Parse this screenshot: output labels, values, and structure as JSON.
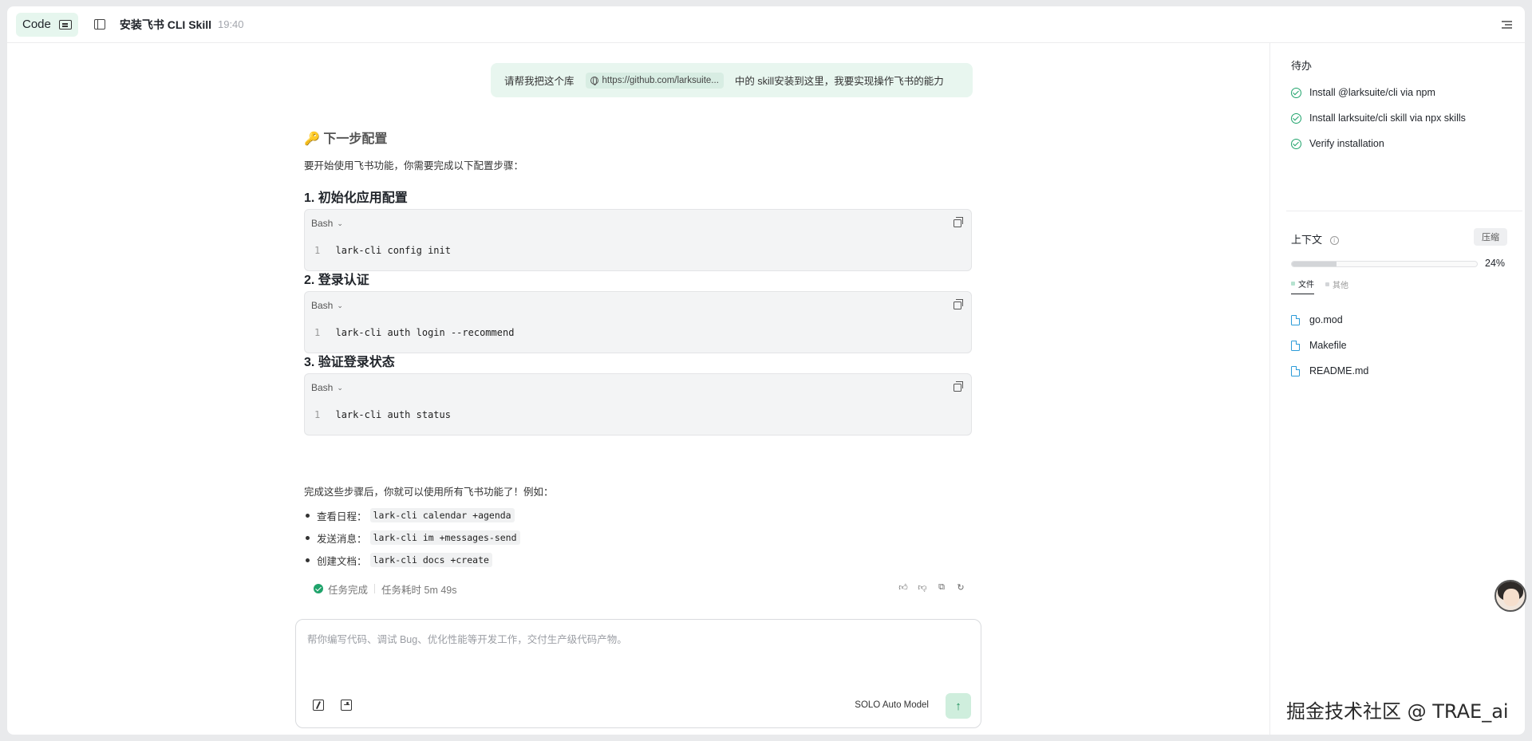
{
  "header": {
    "code_label": "Code",
    "title": "安装飞书 CLI Skill",
    "time": "19:40"
  },
  "user_message": {
    "prefix": "请帮我把这个库",
    "link": "https://github.com/larksuite...",
    "suffix": "中的 skill安装到这里，我要实现操作飞书的能力"
  },
  "response": {
    "next_heading": "🔑 下一步配置",
    "intro": "要开始使用飞书功能，你需要完成以下配置步骤：",
    "steps": [
      {
        "heading": "1. 初始化应用配置",
        "lang": "Bash",
        "line_no": "1",
        "code": "lark-cli config init"
      },
      {
        "heading": "2. 登录认证",
        "lang": "Bash",
        "line_no": "1",
        "code": "lark-cli auth login --recommend"
      },
      {
        "heading": "3. 验证登录状态",
        "lang": "Bash",
        "line_no": "1",
        "code": "lark-cli auth status"
      }
    ],
    "outro": "完成这些步骤后，你就可以使用所有飞书功能了！例如：",
    "examples": [
      {
        "label": "查看日程：",
        "code": "lark-cli calendar +agenda"
      },
      {
        "label": "发送消息：",
        "code": "lark-cli im +messages-send"
      },
      {
        "label": "创建文档：",
        "code": "lark-cli docs +create"
      }
    ],
    "status": "任务完成",
    "duration": "任务耗时 5m 49s"
  },
  "composer": {
    "placeholder": "帮你编写代码、调试 Bug、优化性能等开发工作，交付生产级代码产物。",
    "model": "SOLO Auto Model"
  },
  "sidebar": {
    "todo_title": "待办",
    "todos": [
      "Install @larksuite/cli via npm",
      "Install larksuite/cli skill via npx skills",
      "Verify installation"
    ],
    "context_title": "上下文",
    "compress_label": "压缩",
    "context_percent_value": 24,
    "context_percent": "24%",
    "legend": [
      {
        "label": "文件",
        "color": "#b6e3d0"
      },
      {
        "label": "其他",
        "color": "#d3d5d8"
      }
    ],
    "files": [
      "go.mod",
      "Makefile",
      "README.md"
    ]
  },
  "watermark": "掘金技术社区 @ TRAE_ai",
  "colors": {
    "accent": "#1fa36b",
    "bubble": "#e8f6ef",
    "file_icon": "#2b9bd8"
  }
}
